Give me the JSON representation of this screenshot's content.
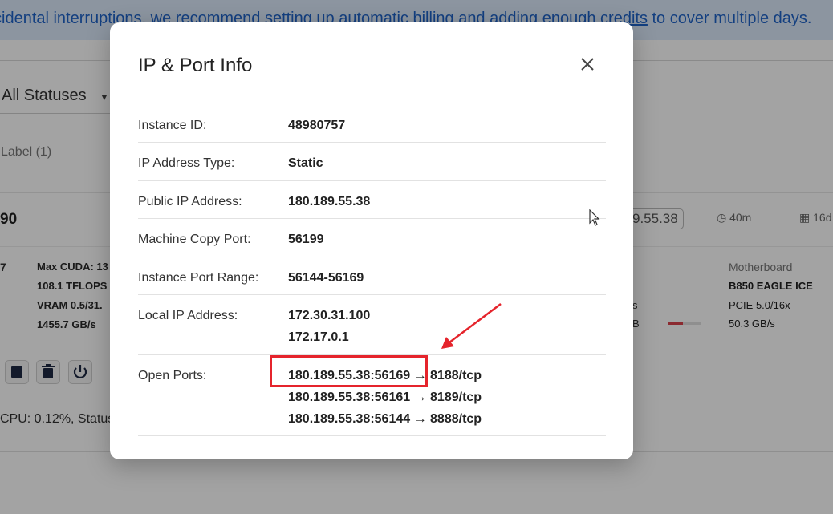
{
  "banner": {
    "prefix": "cidental interruptions, we recommend setting up automatic billing and adding enough ",
    "link": "credits",
    "suffix": " to cover multiple days."
  },
  "filters": {
    "status_value": "All Statuses",
    "label_filter": "Label (1)"
  },
  "instance_row": {
    "gpu_fragment": "90",
    "ip_fragment": "9.55.38",
    "age": "40m",
    "days": "16d",
    "seven": "7",
    "specs": [
      "Max CUDA: 13",
      "108.1 TFLOPS",
      "VRAM 0.5/31.",
      "1455.7 GB/s"
    ],
    "mid_frag_1": "s",
    "mid_frag_2": "B",
    "disk_usage_fraction": 0.45,
    "motherboard_label": "Motherboard",
    "motherboard_name": "B850 EAGLE ICE",
    "pcie": "PCIE 5.0/16x",
    "pcie_bw": "50.3 GB/s",
    "cpu_status": "CPU: 0.12%, Status"
  },
  "modal": {
    "title": "IP & Port Info",
    "rows": [
      {
        "key": "Instance ID:",
        "value": "48980757"
      },
      {
        "key": "IP Address Type:",
        "value": "Static"
      },
      {
        "key": "Public IP Address:",
        "value": "180.189.55.38"
      },
      {
        "key": "Machine Copy Port:",
        "value": "56199"
      },
      {
        "key": "Instance Port Range:",
        "value": "56144-56169"
      }
    ],
    "local_ip": {
      "key": "Local IP Address:",
      "values": [
        "172.30.31.100",
        "172.17.0.1"
      ]
    },
    "open_ports": {
      "key": "Open Ports:",
      "values": [
        "180.189.55.38:56169 → 8188/tcp",
        "180.189.55.38:56161 → 8189/tcp",
        "180.189.55.38:56144 → 8888/tcp"
      ]
    }
  },
  "colors": {
    "banner_bg": "#dbe9fb",
    "banner_text": "#1f63c8",
    "annotation": "#e5242c"
  }
}
